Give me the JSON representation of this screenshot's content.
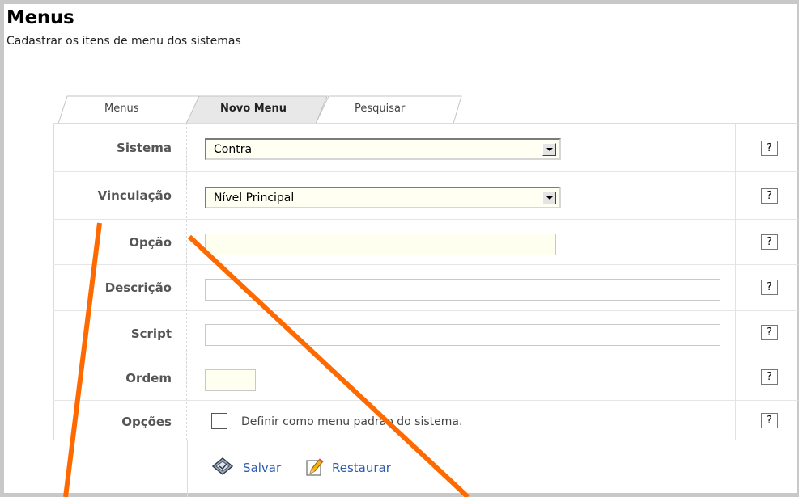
{
  "page": {
    "title": "Menus",
    "subtitle": "Cadastrar os itens de menu dos sistemas"
  },
  "tabs": [
    {
      "label": "Menus",
      "active": false
    },
    {
      "label": "Novo Menu",
      "active": true
    },
    {
      "label": "Pesquisar",
      "active": false
    }
  ],
  "form": {
    "sistema": {
      "label": "Sistema",
      "value": "Contra"
    },
    "vinculacao": {
      "label": "Vinculação",
      "value": "Nível Principal"
    },
    "opcao": {
      "label": "Opção",
      "value": ""
    },
    "descricao": {
      "label": "Descrição",
      "value": ""
    },
    "script": {
      "label": "Script",
      "value": ""
    },
    "ordem": {
      "label": "Ordem",
      "value": ""
    },
    "opcoes": {
      "label": "Opções",
      "checkbox_label": "Definir como menu padrão do sistema.",
      "checked": false
    },
    "help_label": "?"
  },
  "actions": {
    "save_label": "Salvar",
    "restore_label": "Restaurar"
  },
  "colors": {
    "annotation": "#ff6a00",
    "link": "#2d5db0",
    "label": "#555555"
  }
}
